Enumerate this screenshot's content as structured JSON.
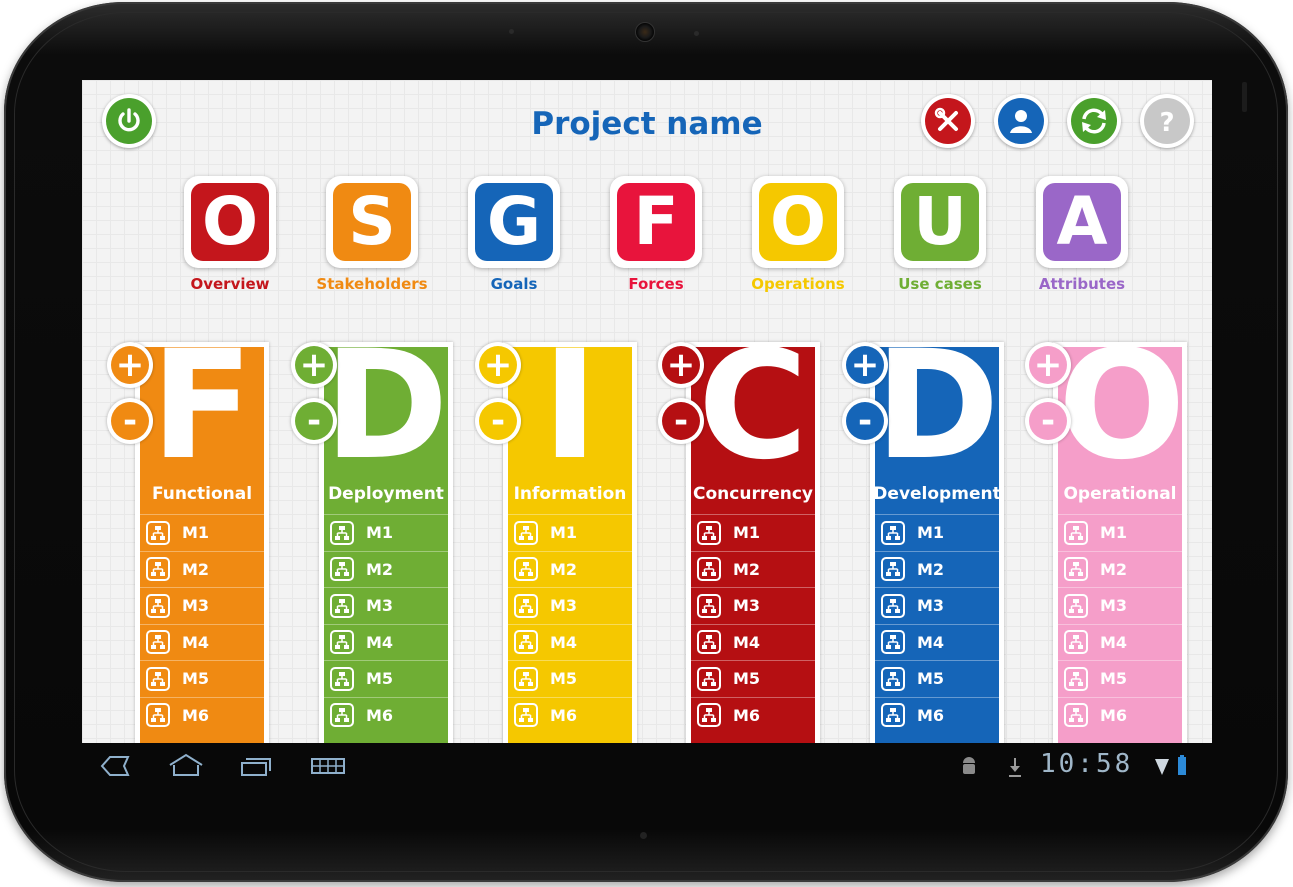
{
  "header": {
    "title": "Project name"
  },
  "top_buttons": [
    {
      "name": "tools",
      "color": "#c4161c"
    },
    {
      "name": "user",
      "color": "#1565b8"
    },
    {
      "name": "sync",
      "color": "#4aa02c"
    },
    {
      "name": "help",
      "color": "#c8c8c8"
    }
  ],
  "power_color": "#4aa02c",
  "sections": [
    {
      "letter": "O",
      "label": "Overview",
      "color": "#c4161c"
    },
    {
      "letter": "S",
      "label": "Stakeholders",
      "color": "#f08a12"
    },
    {
      "letter": "G",
      "label": "Goals",
      "color": "#1565b8"
    },
    {
      "letter": "F",
      "label": "Forces",
      "color": "#e8143c"
    },
    {
      "letter": "O",
      "label": "Operations",
      "color": "#f5c800"
    },
    {
      "letter": "U",
      "label": "Use cases",
      "color": "#6fae34"
    },
    {
      "letter": "A",
      "label": "Attributes",
      "color": "#9a67c8"
    }
  ],
  "views": [
    {
      "letter": "F",
      "name": "Functional",
      "color": "#f08a12",
      "models": [
        "M1",
        "M2",
        "M3",
        "M4",
        "M5",
        "M6"
      ]
    },
    {
      "letter": "D",
      "name": "Deployment",
      "color": "#6fae34",
      "models": [
        "M1",
        "M2",
        "M3",
        "M4",
        "M5",
        "M6"
      ]
    },
    {
      "letter": "I",
      "name": "Information",
      "color": "#f5c800",
      "models": [
        "M1",
        "M2",
        "M3",
        "M4",
        "M5",
        "M6"
      ]
    },
    {
      "letter": "C",
      "name": "Concurrency",
      "color": "#b50f12",
      "models": [
        "M1",
        "M2",
        "M3",
        "M4",
        "M5",
        "M6"
      ]
    },
    {
      "letter": "D",
      "name": "Development",
      "color": "#1565b8",
      "models": [
        "M1",
        "M2",
        "M3",
        "M4",
        "M5",
        "M6"
      ]
    },
    {
      "letter": "O",
      "name": "Operational",
      "color": "#f59ec9",
      "models": [
        "M1",
        "M2",
        "M3",
        "M4",
        "M5",
        "M6"
      ]
    }
  ],
  "plus_label": "+",
  "minus_label": "-",
  "status_bar": {
    "time": "10:58"
  }
}
